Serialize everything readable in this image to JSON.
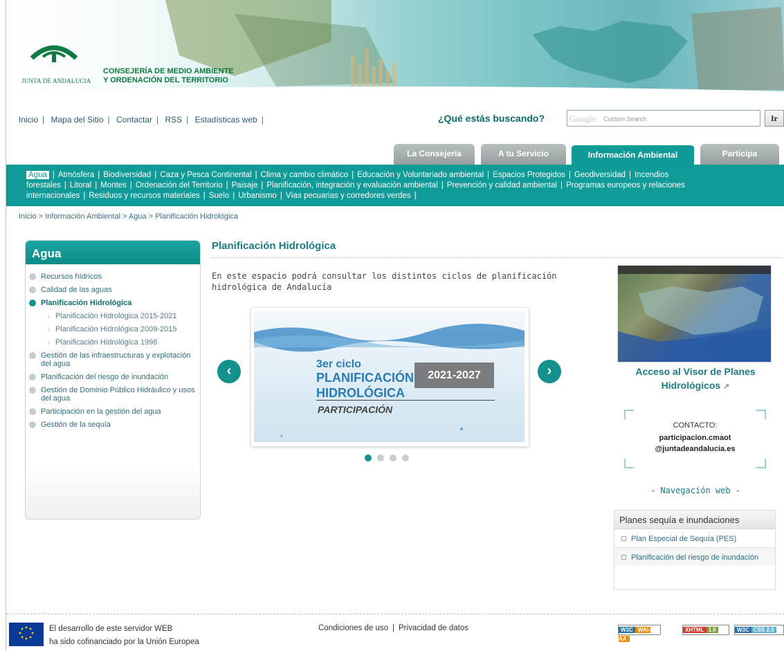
{
  "header": {
    "logo_text": "JUNTA DE ANDALUCIA",
    "consejeria_line1": "CONSEJERÍA DE MEDIO AMBIENTE",
    "consejeria_line2": "Y ORDENACIÓN DEL TERRITORIO"
  },
  "topnav": {
    "items": [
      "Inicio",
      "Mapa del Sitio",
      "Contactar",
      "RSS",
      "Estadísticas web"
    ],
    "sep": "|"
  },
  "search": {
    "label": "¿Qué estás buscando?",
    "google_logo": "Google",
    "placeholder": "Custom Search",
    "button": "Ir"
  },
  "tabs": [
    "La Consejería",
    "A tu Servicio",
    "Información Ambiental",
    "Participa"
  ],
  "active_tab": "Información Ambiental",
  "subnav": [
    "Agua",
    "Atmósfera",
    "Biodiversidad",
    "Caza y Pesca Continental",
    "Clima y cambio climático",
    "Educación y Voluntariado ambiental",
    "Espacios Protegidos",
    "Geodiversidad",
    "Incendios forestales",
    "Litoral",
    "Montes",
    "Ordenación del Territorio",
    "Paisaje",
    "Planificación, integración y evaluación ambiental",
    "Prevención y calidad ambiental",
    "Programas europeos y relaciones internacionales",
    "Residuos y recursos materiales",
    "Suelo",
    "Urbanismo",
    "Vías pecuarias y corredores verdes"
  ],
  "breadcrumb": "Inicio > Información Ambiental > Agua > Planificación Hidrológica",
  "sidebar": {
    "title": "Agua",
    "items": [
      {
        "label": "Recursos hídricos",
        "type": "item"
      },
      {
        "label": "Calidad de las aguas",
        "type": "item"
      },
      {
        "label": "Planificación Hidrológica",
        "type": "active"
      },
      {
        "label": "Planificación Hidrológica 2015-2021",
        "type": "sub"
      },
      {
        "label": "Planificación Hidrológica 2009-2015",
        "type": "sub"
      },
      {
        "label": "Planificación Hidrológica 1998",
        "type": "sub"
      },
      {
        "label": "Gestión de las infraestructuras y explotación del agua",
        "type": "item"
      },
      {
        "label": "Planificación del riesgo de inundación",
        "type": "item"
      },
      {
        "label": "Gestión de Dominio Público Hidráulico y usos del agua",
        "type": "item"
      },
      {
        "label": "Participación en la gestión del agua",
        "type": "item"
      },
      {
        "label": "Gestión de la sequía",
        "type": "item"
      }
    ]
  },
  "main": {
    "title": "Planificación Hidrológica",
    "intro": "En este espacio podrá consultar los distintos ciclos de planificación hidrológica de Andalucía",
    "slide": {
      "ciclo": "3er ciclo",
      "plan_line1": "PLANIFICACIÓN",
      "plan_line2": "HIDROLÓGICA",
      "years": "2021-2027",
      "participacion": "PARTICIPACIÓN"
    },
    "prev": "‹",
    "next": "›",
    "dots_total": 4,
    "dots_active": 1
  },
  "right": {
    "visor_line1": "Acceso al Visor de Planes",
    "visor_line2": "Hidrológicos",
    "contact_title": "CONTACTO:",
    "contact_mail1": "participacion.cmaot",
    "contact_mail2": "@juntadeandalucia.es",
    "navweb": "- Navegación web -",
    "panel_title": "Planes sequía e inundaciones",
    "panel_items": [
      "Plan Especial de Sequía (PES)",
      "Planificación del riesgo de inundación"
    ]
  },
  "footer": {
    "eu_line1": "El desarrollo de este servidor WEB",
    "eu_line2": "ha sido cofinanciado por la Unión Europea",
    "conditions": "Condiciones de uso",
    "privacy": "Privacidad de datos",
    "badge1a": "W3C",
    "badge1b": "WAI-AA",
    "badge2a": "XHTML",
    "badge2b": "1.0",
    "badge3a": "W3C",
    "badge3b": "CSS 2.0"
  },
  "colors": {
    "accent": "#119b98",
    "link": "#1a7a86"
  },
  "icons": [
    "junta-logo-icon",
    "chevron-left-icon",
    "chevron-right-icon",
    "external-link-icon",
    "eu-flag-icon",
    "bullet-icon"
  ]
}
